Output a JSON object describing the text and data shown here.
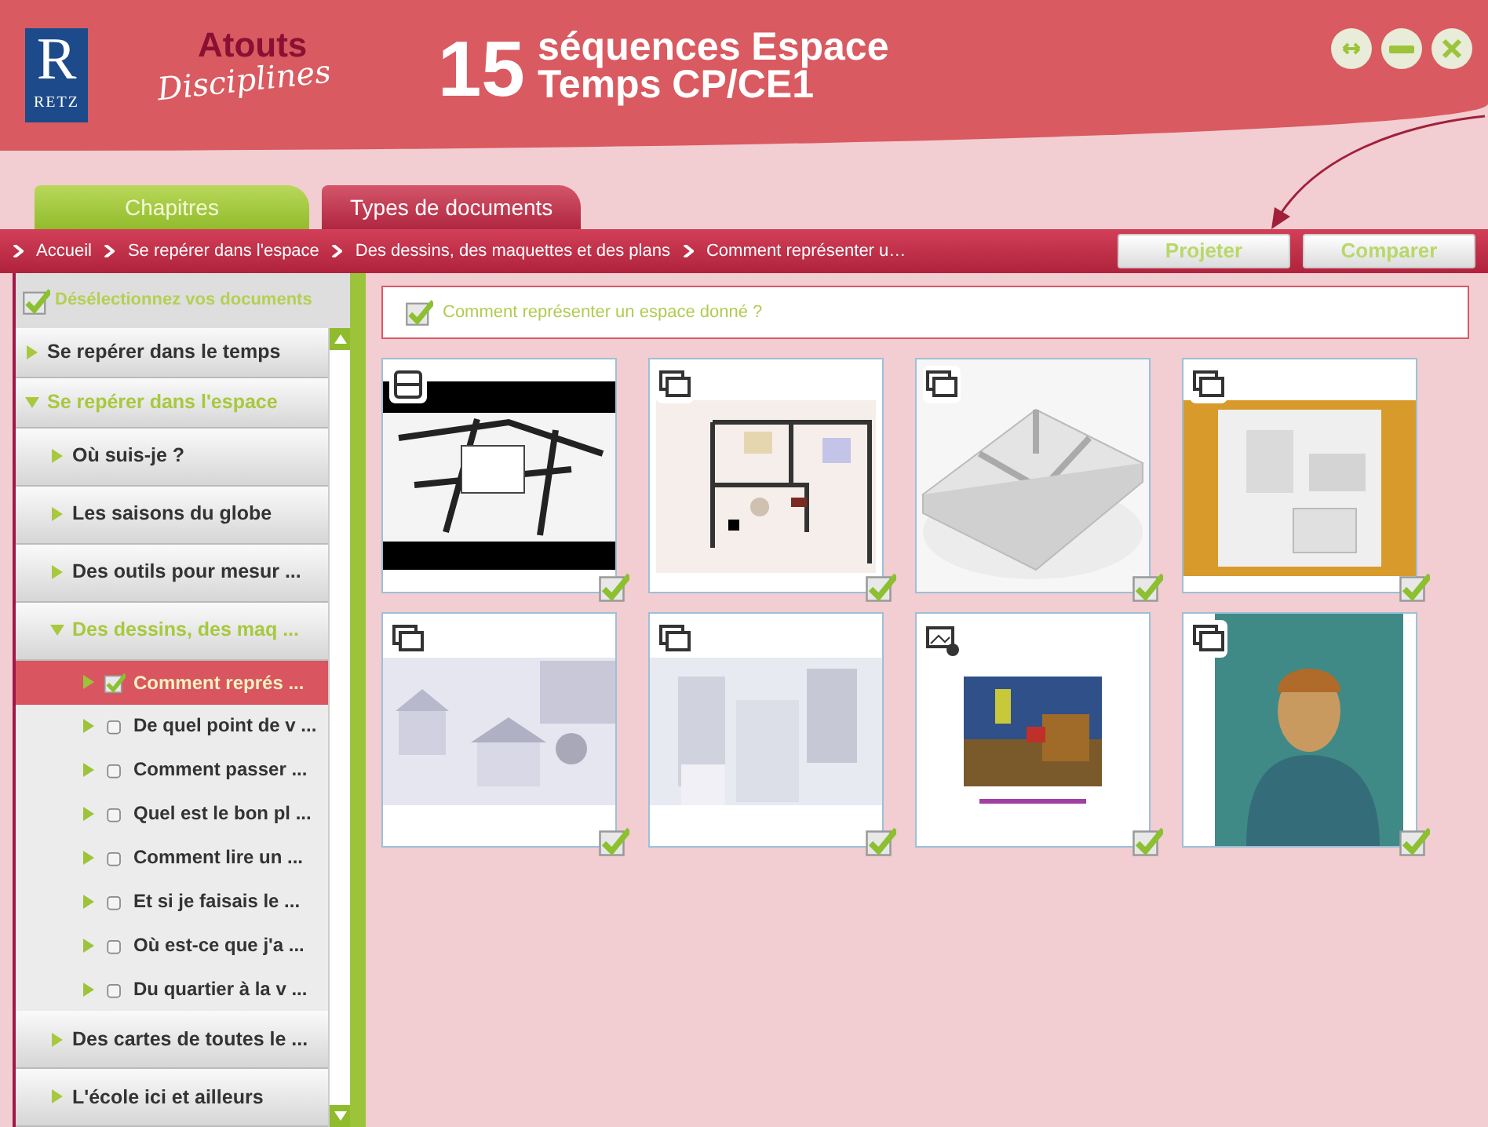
{
  "header": {
    "logo_letter": "R",
    "logo_name": "RETZ",
    "brand_line1": "Atouts",
    "brand_line2": "Disciplines",
    "number": "15",
    "title_line1": "séquences Espace",
    "title_line2": "Temps CP/CE1"
  },
  "window_controls": [
    {
      "kind": "resize"
    },
    {
      "kind": "minimize"
    },
    {
      "kind": "close"
    }
  ],
  "tabs": [
    {
      "label": "Chapitres",
      "selected": true
    },
    {
      "label": "Types de documents",
      "selected": false
    }
  ],
  "breadcrumb": [
    "Accueil",
    "Se repérer dans l'espace",
    "Des dessins, des maquettes et des plans",
    "Comment représenter u…"
  ],
  "actions": [
    {
      "label": "Projeter"
    },
    {
      "label": "Comparer"
    }
  ],
  "sidebar": {
    "deselect": "Désélectionnez vos documents",
    "items": [
      {
        "label": "Se repérer dans le temps",
        "expanded": false
      },
      {
        "label": "Se repérer dans l'espace",
        "expanded": true,
        "children": [
          {
            "label": "Où suis-je ?",
            "expanded": false
          },
          {
            "label": "Les saisons du globe",
            "expanded": false
          },
          {
            "label": "Des outils pour mesur ...",
            "expanded": false
          },
          {
            "label": "Des dessins, des maq ...",
            "expanded": true,
            "children": [
              {
                "label": "Comment représ ...",
                "selected": true,
                "checked": true
              },
              {
                "label": "De quel point de v ...",
                "selected": false,
                "checked": false
              },
              {
                "label": "Comment passer ...",
                "selected": false,
                "checked": false
              },
              {
                "label": "Quel est le bon pl ...",
                "selected": false,
                "checked": false
              },
              {
                "label": "Comment lire un ...",
                "selected": false,
                "checked": false
              },
              {
                "label": "Et si je faisais le ...",
                "selected": false,
                "checked": false
              },
              {
                "label": "Où est-ce que j'a ...",
                "selected": false,
                "checked": false
              },
              {
                "label": "Du quartier à la v ...",
                "selected": false,
                "checked": false
              }
            ]
          },
          {
            "label": "Des cartes de toutes le ...",
            "expanded": false
          },
          {
            "label": "L'école ici et ailleurs",
            "expanded": false
          }
        ]
      }
    ]
  },
  "content": {
    "heading": "Comment représenter un espace donné ?",
    "heading_checked": true,
    "documents": [
      {
        "kind": "sequence",
        "checked": true
      },
      {
        "kind": "slideshow",
        "checked": true
      },
      {
        "kind": "slideshow",
        "checked": true
      },
      {
        "kind": "slideshow",
        "checked": true
      },
      {
        "kind": "slideshow",
        "checked": true
      },
      {
        "kind": "slideshow",
        "checked": true
      },
      {
        "kind": "media",
        "checked": true
      },
      {
        "kind": "slideshow",
        "checked": true
      }
    ]
  }
}
